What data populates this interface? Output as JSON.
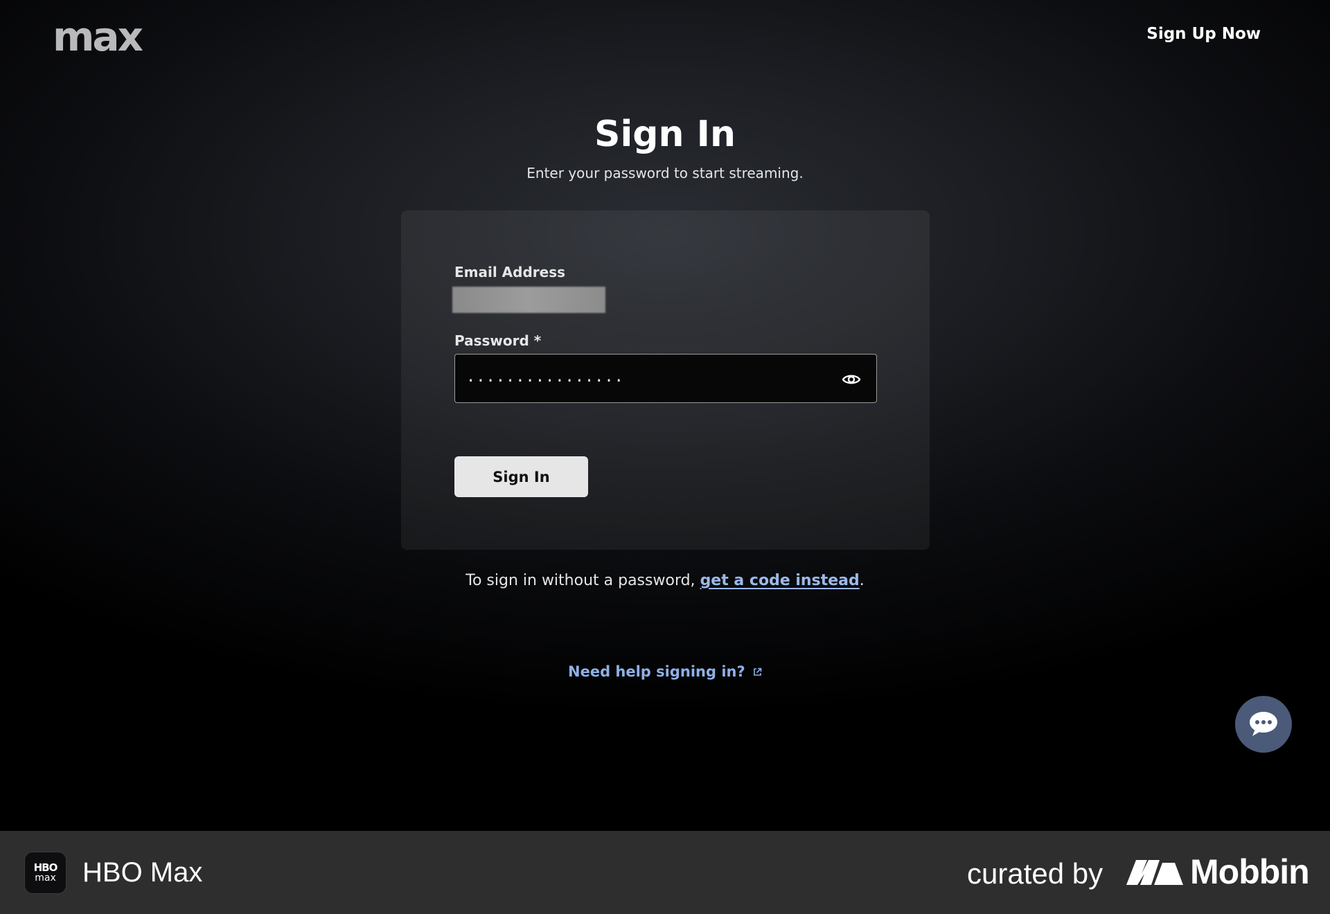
{
  "header": {
    "logo": "max",
    "signup_label": "Sign Up Now"
  },
  "main": {
    "title": "Sign In",
    "subtitle": "Enter your password to start streaming.",
    "email_label": "Email Address",
    "password_label": "Password *",
    "password_value": "................",
    "signin_label": "Sign In",
    "code_prefix": "To sign in without a password, ",
    "code_link": "get a code instead",
    "code_suffix": ".",
    "help_link": "Need help signing in?"
  },
  "footer": {
    "app_icon_top": "HBO",
    "app_icon_bottom": "max",
    "app_name": "HBO Max",
    "curated_label": "curated by",
    "brand_name": "Mobbin"
  },
  "icons": {
    "password_toggle": "eye-icon",
    "help_external": "external-link-icon",
    "chat": "chat-bubble-icon"
  },
  "colors": {
    "link": "#9bb9ea",
    "chat_button": "#4b5a78",
    "button_bg": "#e6e6e6",
    "footer_bg": "#2e2e2e"
  }
}
